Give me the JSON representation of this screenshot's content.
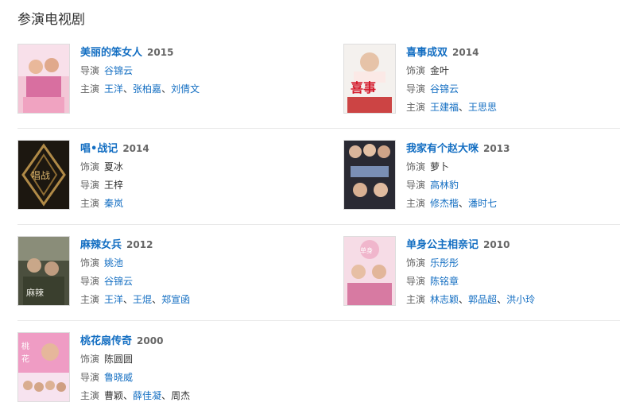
{
  "section_title": "参演电视剧",
  "labels": {
    "role": "饰演",
    "director": "导演",
    "cast": "主演"
  },
  "items": [
    {
      "title": "美丽的笨女人",
      "year": "2015",
      "director": "谷锦云",
      "cast": [
        "王洋",
        "张柏嘉",
        "刘倩文"
      ]
    },
    {
      "title": "喜事成双",
      "year": "2014",
      "role": "金叶",
      "director": "谷锦云",
      "cast": [
        "王建福",
        "王思思"
      ]
    },
    {
      "title": "唱•战记",
      "year": "2014",
      "role": "夏冰",
      "director": "王梓",
      "cast": [
        "秦岚"
      ]
    },
    {
      "title": "我家有个赵大咪",
      "year": "2013",
      "role": "萝卜",
      "director": "高林豹",
      "cast": [
        "修杰楷",
        "潘时七"
      ]
    },
    {
      "title": "麻辣女兵",
      "year": "2012",
      "role": "姚池",
      "director": "谷锦云",
      "cast": [
        "王洋",
        "王焜",
        "郑宣函"
      ]
    },
    {
      "title": "单身公主相亲记",
      "year": "2010",
      "role": "乐彤彤",
      "director": "陈铭章",
      "cast": [
        "林志颖",
        "郭品超",
        "洪小玲"
      ]
    },
    {
      "title": "桃花扇传奇",
      "year": "2000",
      "role": "陈圆圆",
      "director": "鲁晓威",
      "cast": [
        "曹颖",
        "薛佳凝",
        "周杰"
      ]
    }
  ],
  "colors": {
    "link": "#136ec2",
    "divider": "#e8e8e8"
  }
}
